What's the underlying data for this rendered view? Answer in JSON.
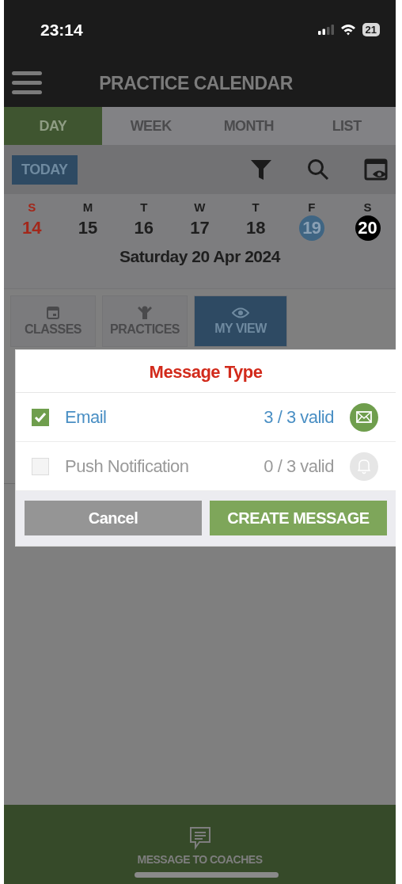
{
  "status_bar": {
    "time": "23:14",
    "battery": "21"
  },
  "header": {
    "title": "PRACTICE CALENDAR"
  },
  "tabs": [
    {
      "label": "DAY",
      "selected": true
    },
    {
      "label": "WEEK",
      "selected": false
    },
    {
      "label": "MONTH",
      "selected": false
    },
    {
      "label": "LIST",
      "selected": false
    }
  ],
  "toolbar": {
    "today_button": "TODAY"
  },
  "week": [
    {
      "letter": "S",
      "number": "14",
      "color": "#a3271a",
      "today": false,
      "selected": false
    },
    {
      "letter": "M",
      "number": "15",
      "color": "#1e1e1e",
      "today": false,
      "selected": false
    },
    {
      "letter": "T",
      "number": "16",
      "color": "#1e1e1e",
      "today": false,
      "selected": false
    },
    {
      "letter": "W",
      "number": "17",
      "color": "#1e1e1e",
      "today": false,
      "selected": false
    },
    {
      "letter": "T",
      "number": "18",
      "color": "#1e1e1e",
      "today": false,
      "selected": false
    },
    {
      "letter": "F",
      "number": "19",
      "color": "#1e1e1e",
      "today": true,
      "selected": false
    },
    {
      "letter": "S",
      "number": "20",
      "color": "#1e1e1e",
      "today": false,
      "selected": true
    }
  ],
  "date_label": "Saturday 20 Apr 2024",
  "view_tabs": [
    {
      "label": "CLASSES",
      "kind": "calendar",
      "selected": false
    },
    {
      "label": "PRACTICES",
      "kind": "person",
      "selected": false
    },
    {
      "label": "MY VIEW",
      "kind": "eye",
      "selected": true
    }
  ],
  "dialog": {
    "title": "Message Type",
    "options": [
      {
        "label": "Email",
        "count": "3 / 3 valid",
        "kind": "email",
        "checked": true
      },
      {
        "label": "Push Notification",
        "count": "0 / 3 valid",
        "kind": "push",
        "checked": false
      }
    ],
    "cancel": "Cancel",
    "confirm": "CREATE MESSAGE"
  },
  "bottom_bar": {
    "label": "MESSAGE TO COACHES"
  }
}
